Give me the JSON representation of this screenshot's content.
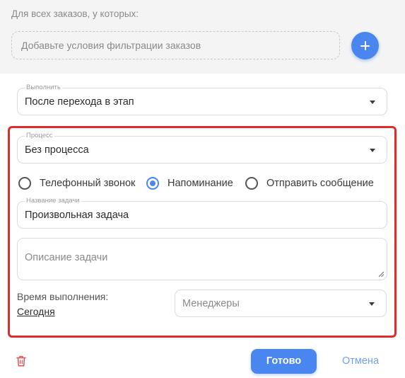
{
  "filter": {
    "heading": "Для всех заказов, у которых:",
    "placeholder": "Добавьте условия фильтрации заказов",
    "add_icon": "plus-icon"
  },
  "execute": {
    "legend": "Выполнить",
    "value": "После перехода в этап"
  },
  "process": {
    "legend": "Процесс",
    "value": "Без процесса"
  },
  "task_type": {
    "options": [
      {
        "label": "Телефонный звонок",
        "checked": false
      },
      {
        "label": "Напоминание",
        "checked": true
      },
      {
        "label": "Отправить сообщение",
        "checked": false
      }
    ]
  },
  "task_name": {
    "legend": "Название задачи",
    "value": "Произвольная задача"
  },
  "task_description": {
    "placeholder": "Описание задачи"
  },
  "execution_time": {
    "label": "Время выполнения:",
    "value": "Сегодня"
  },
  "managers": {
    "placeholder": "Менеджеры"
  },
  "actions": {
    "done_label": "Готово",
    "cancel_label": "Отмена",
    "delete_icon": "trash-icon"
  },
  "colors": {
    "accent": "#4a86f0",
    "highlight": "#e02b2b",
    "delete": "#e05252"
  }
}
